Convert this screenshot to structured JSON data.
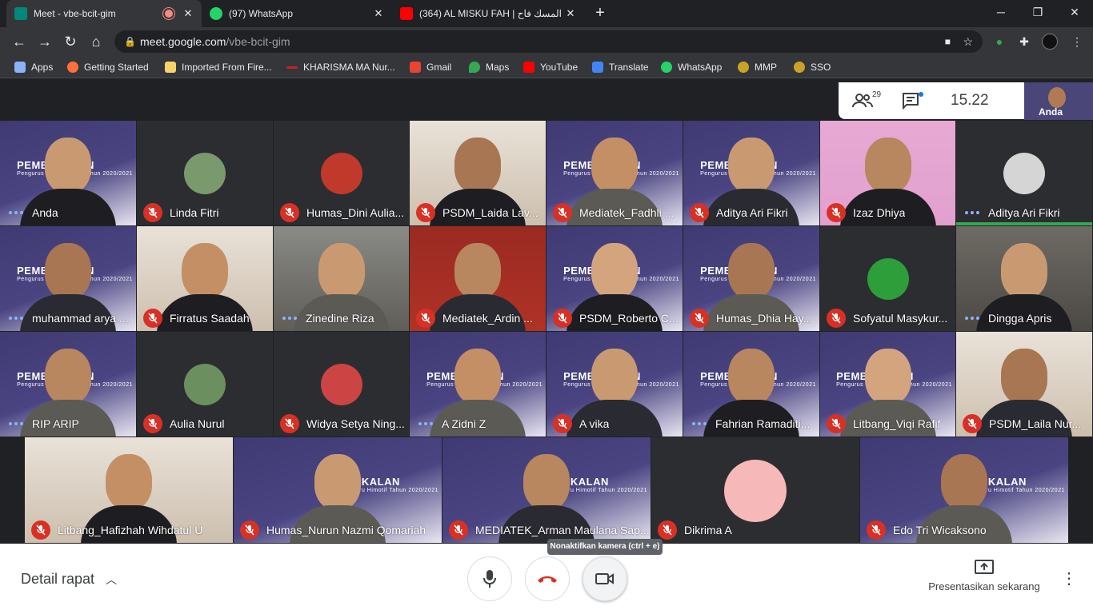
{
  "browser": {
    "tabs": [
      {
        "title": "Meet - vbe-bcit-gim",
        "fav_color": "#00897b",
        "recording": true
      },
      {
        "title": "(97) WhatsApp",
        "fav_color": "#25d366"
      },
      {
        "title": "(364) AL MISKU FAH | المسك فاح",
        "fav_color": "#ff0000"
      }
    ],
    "close_label": "✕",
    "new_tab_label": "+",
    "window": {
      "minimize": "─",
      "maximize": "❐",
      "close": "✕"
    },
    "url_host": "meet.google.com",
    "url_path": "/vbe-bcit-gim",
    "bookmarks": [
      {
        "label": "Apps",
        "color": "#8ab4f8"
      },
      {
        "label": "Getting Started",
        "color": "#ff7139"
      },
      {
        "label": "Imported From Fire...",
        "color": "#f6d36b"
      },
      {
        "label": "KHARISMA MA Nur...",
        "color": "#c5221f"
      },
      {
        "label": "Gmail",
        "color": "#ea4335"
      },
      {
        "label": "Maps",
        "color": "#34a853"
      },
      {
        "label": "YouTube",
        "color": "#ff0000"
      },
      {
        "label": "Translate",
        "color": "#4285f4"
      },
      {
        "label": "WhatsApp",
        "color": "#25d366"
      },
      {
        "label": "MMP",
        "color": "#c9a227"
      },
      {
        "label": "SSO",
        "color": "#c9a227"
      }
    ]
  },
  "meet": {
    "participants_count": "29",
    "time": "15.22",
    "self_view_name": "Anda",
    "tiles": [
      {
        "name": "Anda",
        "mic": "speaking",
        "bg": "purple"
      },
      {
        "name": "Linda Fitri",
        "mic": "muted",
        "bg": "dark",
        "avatar": "#7a9a6e"
      },
      {
        "name": "Humas_Dini Aulia...",
        "mic": "muted",
        "bg": "dark",
        "avatar": "#c0392b"
      },
      {
        "name": "PSDM_Laida Lav...",
        "mic": "muted",
        "bg": "light"
      },
      {
        "name": "Mediatek_Fadhli ...",
        "mic": "muted",
        "bg": "purple"
      },
      {
        "name": "Aditya Ari Fikri",
        "mic": "muted",
        "bg": "purple"
      },
      {
        "name": "Izaz Dhiya",
        "mic": "muted",
        "bg": "pink"
      },
      {
        "name": "Aditya Ari Fikri",
        "mic": "speaking",
        "bg": "dark",
        "avatar": "#d5d5d5",
        "active": true
      },
      {
        "name": "muhammad arya ...",
        "mic": "speaking",
        "bg": "purple"
      },
      {
        "name": "Firratus Saadah",
        "mic": "muted",
        "bg": "light"
      },
      {
        "name": "Zinedine Riza",
        "mic": "speaking",
        "bg": "room"
      },
      {
        "name": "Mediatek_Ardin ...",
        "mic": "muted",
        "bg": "red"
      },
      {
        "name": "PSDM_Roberto C...",
        "mic": "muted",
        "bg": "purple"
      },
      {
        "name": "Humas_Dhia Hay...",
        "mic": "muted",
        "bg": "purple"
      },
      {
        "name": "Sofyatul Masykur...",
        "mic": "muted",
        "bg": "dark",
        "avatar": "#2e9e3a"
      },
      {
        "name": "Dingga Apris",
        "mic": "speaking",
        "bg": "gray"
      },
      {
        "name": "RIP ARIP",
        "mic": "speaking",
        "bg": "purple"
      },
      {
        "name": "Aulia Nurul",
        "mic": "muted",
        "bg": "dark",
        "avatar": "#6b8f5e"
      },
      {
        "name": "Widya Setya Ning...",
        "mic": "muted",
        "bg": "dark",
        "avatar": "#c44"
      },
      {
        "name": "A Zidni Z",
        "mic": "speaking",
        "bg": "purple"
      },
      {
        "name": "A vika",
        "mic": "muted",
        "bg": "purple"
      },
      {
        "name": "Fahrian Ramaditi...",
        "mic": "speaking",
        "bg": "purple"
      },
      {
        "name": "Litbang_Viqi Rafif",
        "mic": "muted",
        "bg": "purple"
      },
      {
        "name": "PSDM_Laila Nur...",
        "mic": "muted",
        "bg": "light"
      },
      {
        "name": "Litbang_Hafizhah Wihdatul U",
        "mic": "muted",
        "bg": "light"
      },
      {
        "name": "Humas_Nurun Nazmi Qomariah",
        "mic": "muted",
        "bg": "purple"
      },
      {
        "name": "MEDIATEK_Arman Maulana Sap...",
        "mic": "muted",
        "bg": "purple"
      },
      {
        "name": "Dikrima A",
        "mic": "muted",
        "bg": "dark",
        "avatar": "#f6b8b8"
      },
      {
        "name": "Edo Tri Wicaksono",
        "mic": "muted",
        "bg": "purple"
      }
    ],
    "banner_title": "PEMBEKALAN",
    "banner_sub": "Pengurus Baru Himotif Tahun 2020/2021"
  },
  "tooltip": "Nonaktifkan kamera (ctrl + e)",
  "bottom": {
    "detail_label": "Detail rapat",
    "present_label": "Presentasikan sekarang"
  }
}
